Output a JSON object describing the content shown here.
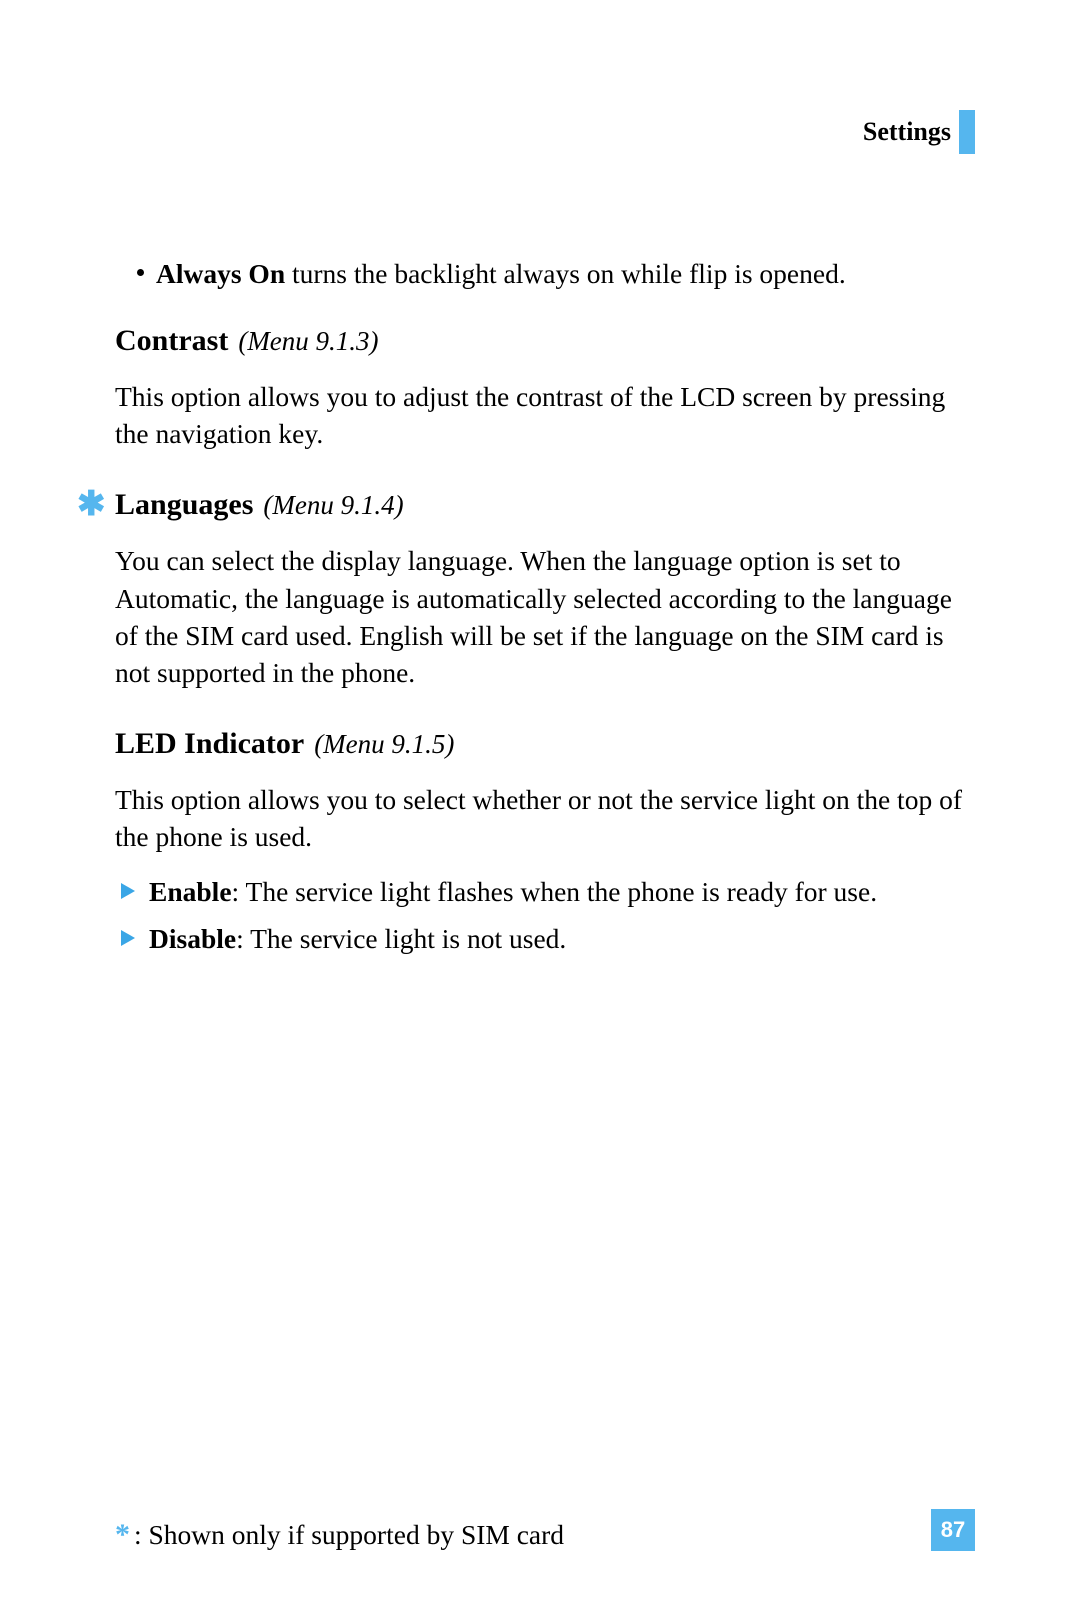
{
  "header": {
    "title": "Settings"
  },
  "always_on": {
    "label": "Always On",
    "text": " turns the backlight always on while flip is opened."
  },
  "contrast": {
    "title": "Contrast",
    "menu": "(Menu 9.1.3)",
    "body": "This option allows you to adjust the contrast of the LCD screen by pressing the navigation key."
  },
  "languages": {
    "title": "Languages",
    "menu": "(Menu 9.1.4)",
    "body": "You can select the display language. When the language option is set to Automatic, the language is automatically selected according to the language of the SIM card used. English will be set if the language on the SIM card is not supported in the phone."
  },
  "led": {
    "title": "LED Indicator",
    "menu": "(Menu 9.1.5)",
    "body": "This option allows you to select whether or not the service light on the top of the phone is used.",
    "items": {
      "enable": {
        "label": "Enable",
        "text": ": The service light flashes when the phone is ready for use."
      },
      "disable": {
        "label": "Disable",
        "text": ": The service light is not used."
      }
    }
  },
  "footnote": {
    "star": "*",
    "text": ": Shown only if supported by SIM card"
  },
  "page_number": "87",
  "icons": {
    "star": "✱"
  }
}
